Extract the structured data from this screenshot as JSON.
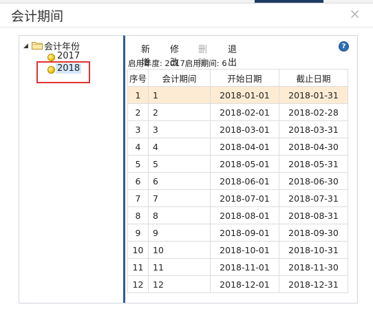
{
  "dialog": {
    "title": "会计期间",
    "close_glyph": "×"
  },
  "tree": {
    "root_label": "会计年份",
    "years": [
      {
        "label": "2017",
        "selected": false
      },
      {
        "label": "2018",
        "selected": true
      }
    ]
  },
  "toolbar": {
    "add_label": "新增",
    "edit_label": "修改",
    "delete_label": "删除",
    "exit_label": "退出",
    "help_glyph": "?"
  },
  "info": {
    "text": "启用年度: 2017启用期间: 6"
  },
  "table": {
    "columns": [
      "序号",
      "会计期间",
      "开始日期",
      "截止日期"
    ],
    "rows": [
      [
        "1",
        "1",
        "2018-01-01",
        "2018-01-31"
      ],
      [
        "2",
        "2",
        "2018-02-01",
        "2018-02-28"
      ],
      [
        "3",
        "3",
        "2018-03-01",
        "2018-03-31"
      ],
      [
        "4",
        "4",
        "2018-04-01",
        "2018-04-30"
      ],
      [
        "5",
        "5",
        "2018-05-01",
        "2018-05-31"
      ],
      [
        "6",
        "6",
        "2018-06-01",
        "2018-06-30"
      ],
      [
        "7",
        "7",
        "2018-07-01",
        "2018-07-31"
      ],
      [
        "8",
        "8",
        "2018-08-01",
        "2018-08-31"
      ],
      [
        "9",
        "9",
        "2018-09-01",
        "2018-09-30"
      ],
      [
        "10",
        "10",
        "2018-10-01",
        "2018-10-31"
      ],
      [
        "11",
        "11",
        "2018-11-01",
        "2018-11-30"
      ],
      [
        "12",
        "12",
        "2018-12-01",
        "2018-12-31"
      ]
    ],
    "selected_row": 0
  },
  "colors": {
    "selected_row_bg": "#fdebd3",
    "accent_bar": "#2f5a91",
    "annotation_box": "#e03131"
  }
}
